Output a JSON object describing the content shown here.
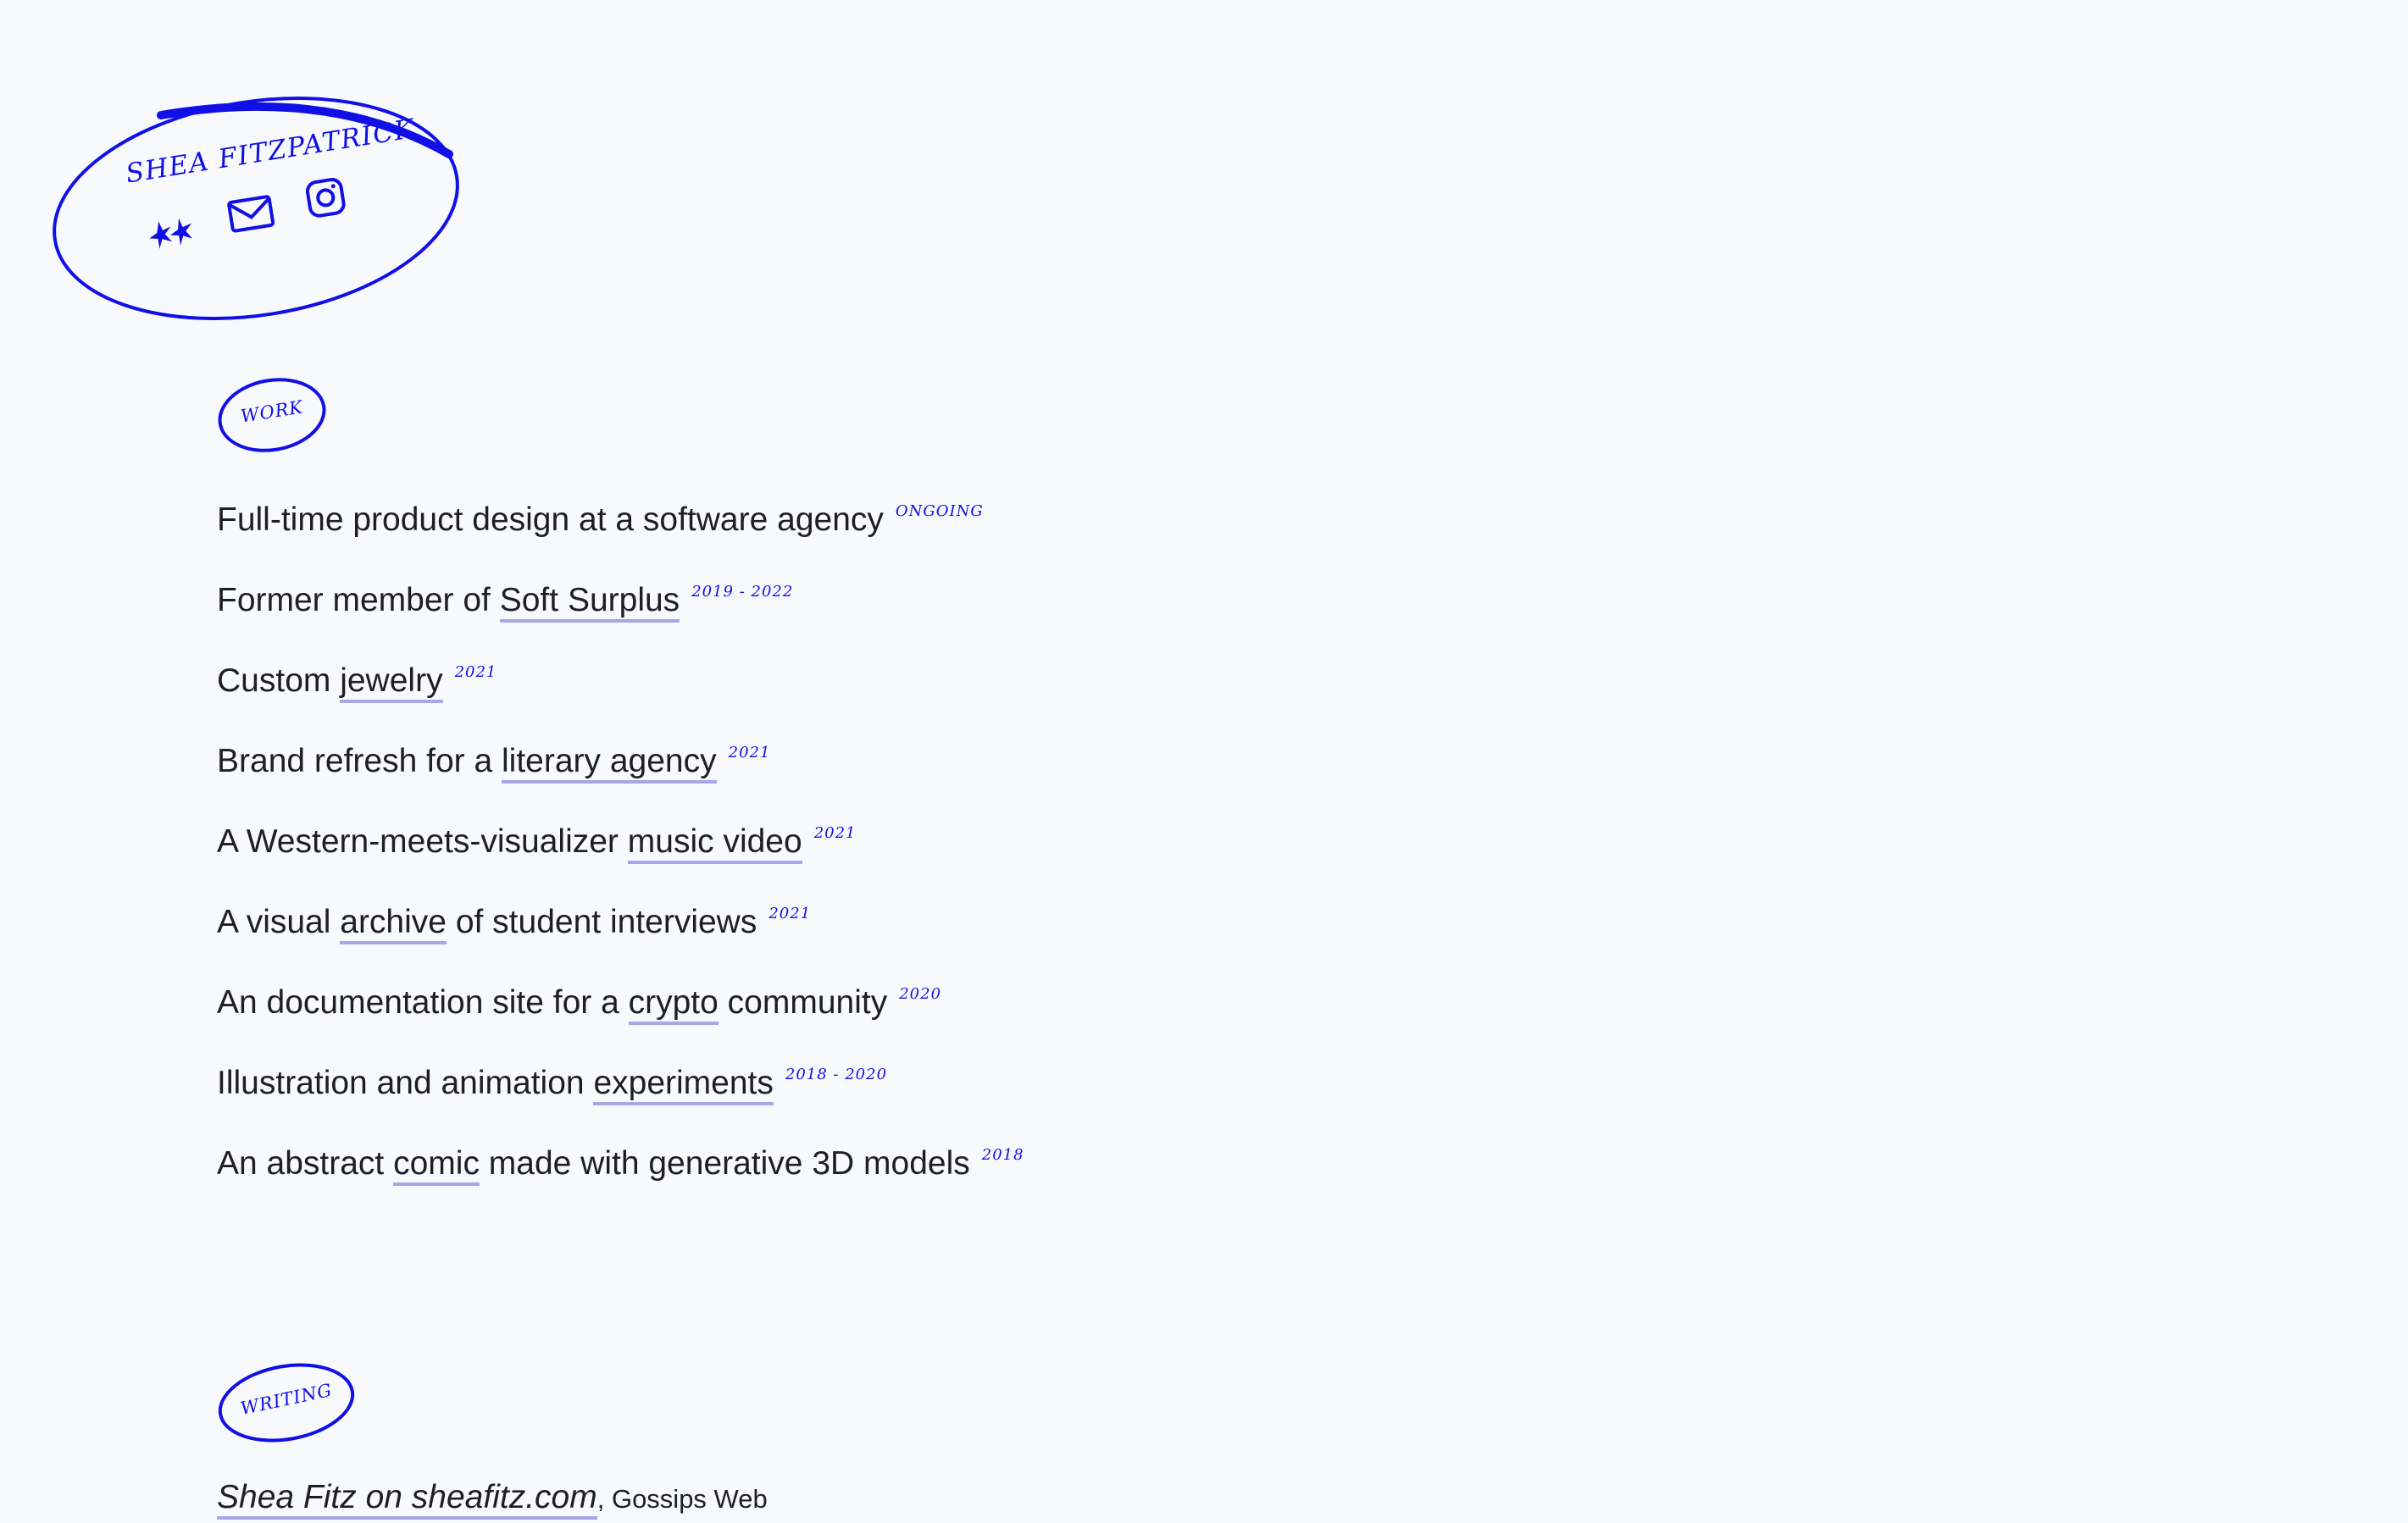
{
  "header": {
    "name": "SHEA FITZPATRICK",
    "icons": [
      "stars-icon",
      "mail-icon",
      "instagram-icon"
    ],
    "accent_color": "#1010e6"
  },
  "work": {
    "section_label": "WORK",
    "items": [
      {
        "pre": "Full-time product design at a software agency",
        "link": "",
        "post": "",
        "year": "ONGOING"
      },
      {
        "pre": "Former member of ",
        "link": "Soft Surplus",
        "post": "",
        "year": "2019 - 2022"
      },
      {
        "pre": "Custom ",
        "link": "jewelry",
        "post": "",
        "year": "2021"
      },
      {
        "pre": "Brand refresh for a ",
        "link": "literary agency",
        "post": "",
        "year": "2021"
      },
      {
        "pre": "A Western-meets-visualizer ",
        "link": "music video",
        "post": "",
        "year": "2021"
      },
      {
        "pre": "A visual ",
        "link": "archive",
        "post": " of student interviews",
        "year": "2021"
      },
      {
        "pre": "An documentation site for a ",
        "link": "crypto",
        "post": " community",
        "year": "2020"
      },
      {
        "pre": "Illustration and animation ",
        "link": "experiments",
        "post": "",
        "year": "2018 - 2020"
      },
      {
        "pre": "An abstract ",
        "link": "comic",
        "post": " made with generative 3D models",
        "year": "2018"
      }
    ]
  },
  "writing": {
    "section_label": "WRITING",
    "items": [
      {
        "link": "Shea Fitz on sheafitz.com",
        "sep": ", ",
        "publication": "Gossips Web"
      }
    ]
  }
}
